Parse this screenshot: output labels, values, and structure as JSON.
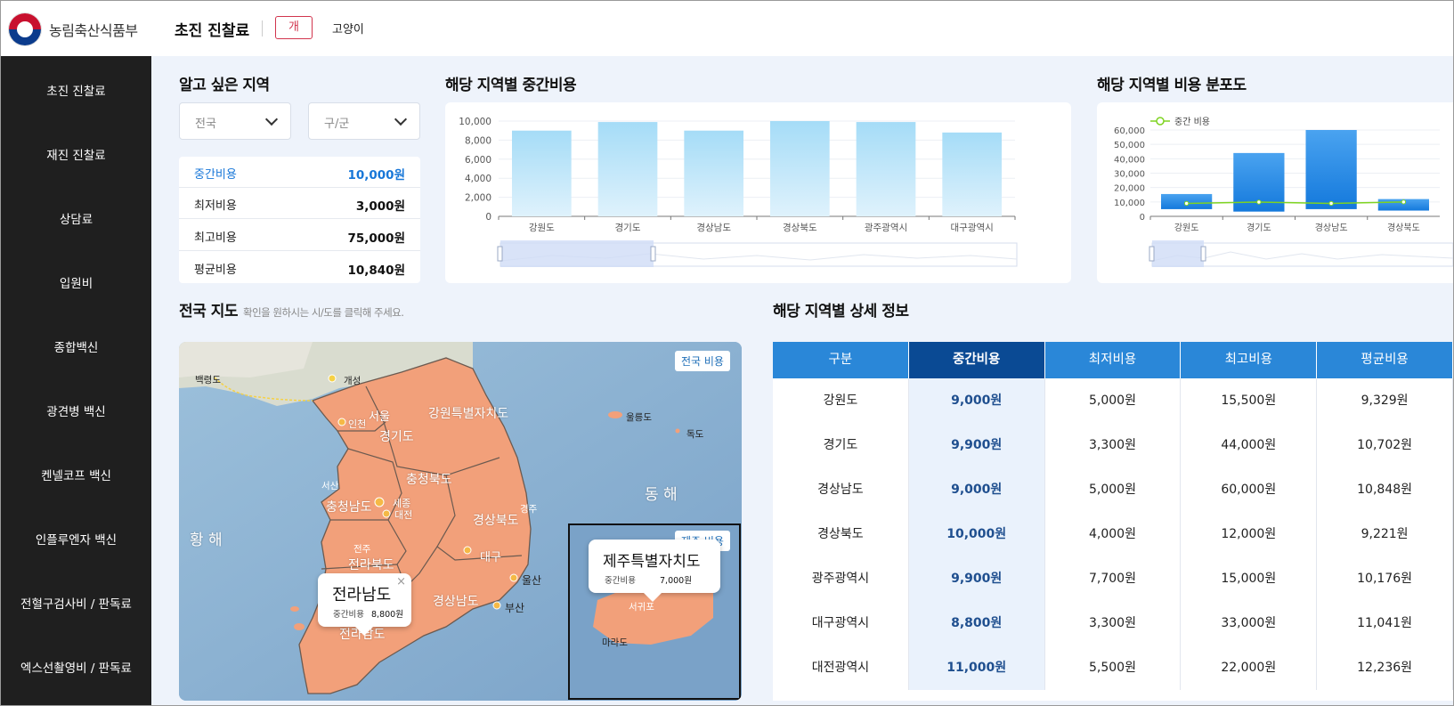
{
  "header": {
    "logo_text": "농림축산식품부",
    "page_title": "초진 진찰료",
    "tabs": [
      {
        "label": "개",
        "active": true
      },
      {
        "label": "고양이",
        "active": false
      }
    ]
  },
  "sidebar": {
    "items": [
      {
        "label": "초진 진찰료"
      },
      {
        "label": "재진 진찰료"
      },
      {
        "label": "상담료"
      },
      {
        "label": "입원비"
      },
      {
        "label": "종합백신"
      },
      {
        "label": "광견병 백신"
      },
      {
        "label": "켄넬코프 백신"
      },
      {
        "label": "인플루엔자 백신"
      },
      {
        "label": "전혈구검사비 / 판독료"
      },
      {
        "label": "엑스선촬영비 / 판독료"
      }
    ]
  },
  "region": {
    "title": "알고 싶은 지역",
    "province_select": "전국",
    "district_select": "구/군",
    "costs": [
      {
        "label": "중간비용",
        "value": "10,000원",
        "highlight": true
      },
      {
        "label": "최저비용",
        "value": "3,000원"
      },
      {
        "label": "최고비용",
        "value": "75,000원"
      },
      {
        "label": "평균비용",
        "value": "10,840원"
      }
    ]
  },
  "median_chart_title": "해당 지역별 중간비용",
  "dist_chart_title": "해당 지역별 비용 분포도",
  "chart_data": [
    {
      "type": "bar",
      "title": "해당 지역별 중간비용",
      "categories": [
        "강원도",
        "경기도",
        "경상남도",
        "경상북도",
        "광주광역시",
        "대구광역시"
      ],
      "values": [
        9000,
        9900,
        9000,
        10000,
        9900,
        8800
      ],
      "yticks": [
        "10,000",
        "8,000",
        "6,000",
        "4,000",
        "2,000",
        "0"
      ],
      "ylim": [
        0,
        10000
      ],
      "bar_color": "#a9dcf6"
    },
    {
      "type": "bar",
      "title": "해당 지역별 비용 분포도",
      "categories": [
        "강원도",
        "경기도",
        "경상남도",
        "경상북도"
      ],
      "series": [
        {
          "kind": "range",
          "low": [
            5000,
            3300,
            5000,
            4000
          ],
          "high": [
            15500,
            44000,
            60000,
            12000
          ]
        },
        {
          "name": "중간 비용",
          "kind": "line",
          "values": [
            9000,
            9900,
            9000,
            10000
          ]
        }
      ],
      "yticks": [
        "60,000",
        "50,000",
        "40,000",
        "30,000",
        "20,000",
        "10,000",
        "0"
      ],
      "ylim": [
        0,
        60000
      ],
      "legend_position": "top-left",
      "bar_color": "#1e88e5",
      "line_color": "#7ed321"
    }
  ],
  "map": {
    "title": "전국 지도",
    "subtitle": "확인을 원하시는 시/도를 클릭해 주세요.",
    "national_badge": "전국 비용",
    "jeju_badge": "제주 비용",
    "sea_east": "동 해",
    "sea_west": "황 해",
    "popup_jeonnam": {
      "name": "전라남도",
      "label": "중간비용",
      "amount": "8,800원"
    },
    "popup_jeju": {
      "name": "제주특별자치도",
      "label": "중간비용",
      "amount": "7,000원"
    },
    "places": [
      {
        "name": "백령도"
      },
      {
        "name": "개성"
      },
      {
        "name": "강원특별자치도"
      },
      {
        "name": "서울"
      },
      {
        "name": "인천"
      },
      {
        "name": "경기도"
      },
      {
        "name": "울릉도"
      },
      {
        "name": "독도"
      },
      {
        "name": "충청북도"
      },
      {
        "name": "서산"
      },
      {
        "name": "충청남도"
      },
      {
        "name": "세종"
      },
      {
        "name": "대전"
      },
      {
        "name": "경주"
      },
      {
        "name": "경상북도"
      },
      {
        "name": "전주"
      },
      {
        "name": "대구"
      },
      {
        "name": "전라북도"
      },
      {
        "name": "울산"
      },
      {
        "name": "경상남도"
      },
      {
        "name": "부산"
      },
      {
        "name": "전라남도"
      },
      {
        "name": "서귀포"
      },
      {
        "name": "마라도"
      }
    ]
  },
  "detail": {
    "title": "해당 지역별 상세 정보",
    "headers": [
      "구분",
      "중간비용",
      "최저비용",
      "최고비용",
      "평균비용"
    ],
    "rows": [
      [
        "강원도",
        "9,000원",
        "5,000원",
        "15,500원",
        "9,329원"
      ],
      [
        "경기도",
        "9,900원",
        "3,300원",
        "44,000원",
        "10,702원"
      ],
      [
        "경상남도",
        "9,000원",
        "5,000원",
        "60,000원",
        "10,848원"
      ],
      [
        "경상북도",
        "10,000원",
        "4,000원",
        "12,000원",
        "9,221원"
      ],
      [
        "광주광역시",
        "9,900원",
        "7,700원",
        "15,000원",
        "10,176원"
      ],
      [
        "대구광역시",
        "8,800원",
        "3,300원",
        "33,000원",
        "11,041원"
      ],
      [
        "대전광역시",
        "11,000원",
        "5,500원",
        "22,000원",
        "12,236원"
      ]
    ]
  }
}
